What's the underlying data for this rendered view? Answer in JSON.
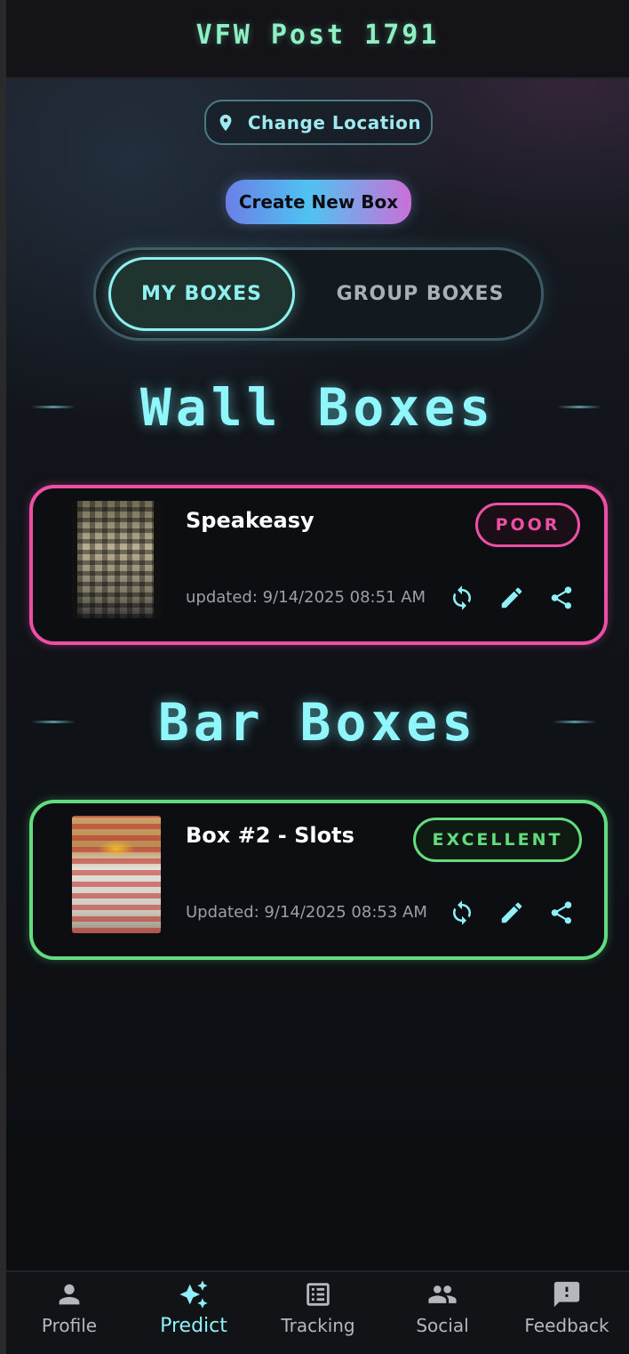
{
  "header": {
    "title": "VFW Post 1791"
  },
  "location": {
    "label": "Change Location",
    "icon": "location-pin-icon"
  },
  "create_button": {
    "label": "Create New Box"
  },
  "tabs": {
    "active": "MY BOXES",
    "inactive": "GROUP BOXES"
  },
  "sections": [
    {
      "title": "Wall Boxes",
      "cards": [
        {
          "title": "Speakeasy",
          "updated": "updated: 9/14/2025 08:51 AM",
          "rating": "POOR",
          "rating_color": "#ec4fa3"
        }
      ]
    },
    {
      "title": "Bar Boxes",
      "cards": [
        {
          "title": "Box #2 - Slots",
          "updated": "Updated: 9/14/2025 08:53 AM",
          "rating": "EXCELLENT",
          "rating_color": "#62dc7e"
        }
      ]
    }
  ],
  "card_actions": [
    "refresh-icon",
    "edit-icon",
    "share-icon"
  ],
  "nav": [
    {
      "label": "Profile",
      "icon": "person-icon",
      "active": false
    },
    {
      "label": "Predict",
      "icon": "sparkle-trend-icon",
      "active": true
    },
    {
      "label": "Tracking",
      "icon": "list-icon",
      "active": false
    },
    {
      "label": "Social",
      "icon": "people-icon",
      "active": false
    },
    {
      "label": "Feedback",
      "icon": "feedback-icon",
      "active": false
    }
  ],
  "colors": {
    "accent": "#8ff0f8",
    "header_title": "#8ff0c4",
    "background": "#0b0d10"
  }
}
